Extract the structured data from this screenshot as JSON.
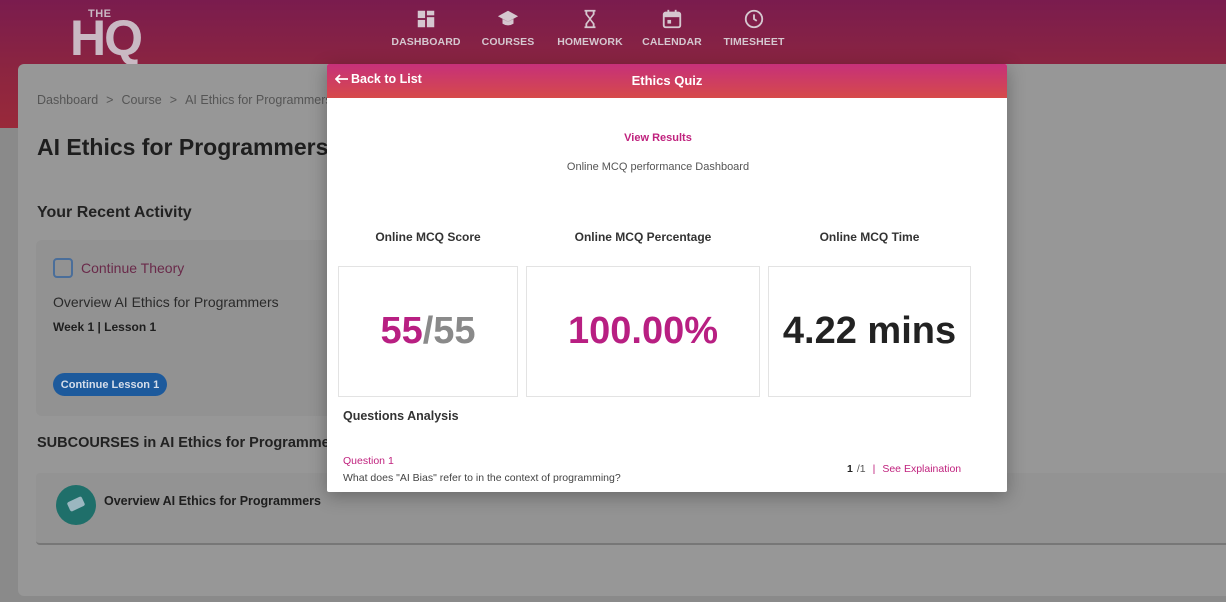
{
  "header": {
    "logo_small": "THE",
    "logo_big": "HQ",
    "nav": [
      {
        "label": "DASHBOARD",
        "icon": "dashboard-icon"
      },
      {
        "label": "COURSES",
        "icon": "graduation-cap-icon"
      },
      {
        "label": "HOMEWORK",
        "icon": "hourglass-icon"
      },
      {
        "label": "CALENDAR",
        "icon": "calendar-icon"
      },
      {
        "label": "TIMESHEET",
        "icon": "clock-icon"
      }
    ]
  },
  "page": {
    "breadcrumb": [
      "Dashboard",
      ">",
      "Course",
      ">",
      "AI Ethics for Programmers"
    ],
    "title": "AI Ethics for Programmers",
    "recent_activity_title": "Your Recent Activity",
    "activity": {
      "link": "Continue Theory",
      "overview": "Overview AI Ethics for Programmers",
      "week": "Week 1 | Lesson 1",
      "button": "Continue Lesson 1"
    },
    "subcourses_title": "SUBCOURSES in AI Ethics for Programmers",
    "subcourse_item": "Overview AI Ethics for Programmers"
  },
  "modal": {
    "back": "Back to List",
    "title": "Ethics Quiz",
    "view_results": "View Results",
    "subtitle": "Online MCQ performance Dashboard",
    "metrics": {
      "score_label": "Online MCQ Score",
      "score_value": "55",
      "score_total": "/55",
      "percentage_label": "Online MCQ Percentage",
      "percentage_value": "100.00%",
      "time_label": "Online MCQ Time",
      "time_value": "4.22 mins"
    },
    "analysis_title": "Questions Analysis",
    "question": {
      "number": "Question 1",
      "text": "What does \"AI Bias\" refer to in the context of programming?",
      "page_current": "1",
      "page_total": "/1",
      "separator": "|",
      "see_link": "See Explaination"
    }
  },
  "colors": {
    "accent": "#c0227e",
    "header_gradient_start": "#c6307a",
    "header_gradient_end": "#d64a4a"
  }
}
